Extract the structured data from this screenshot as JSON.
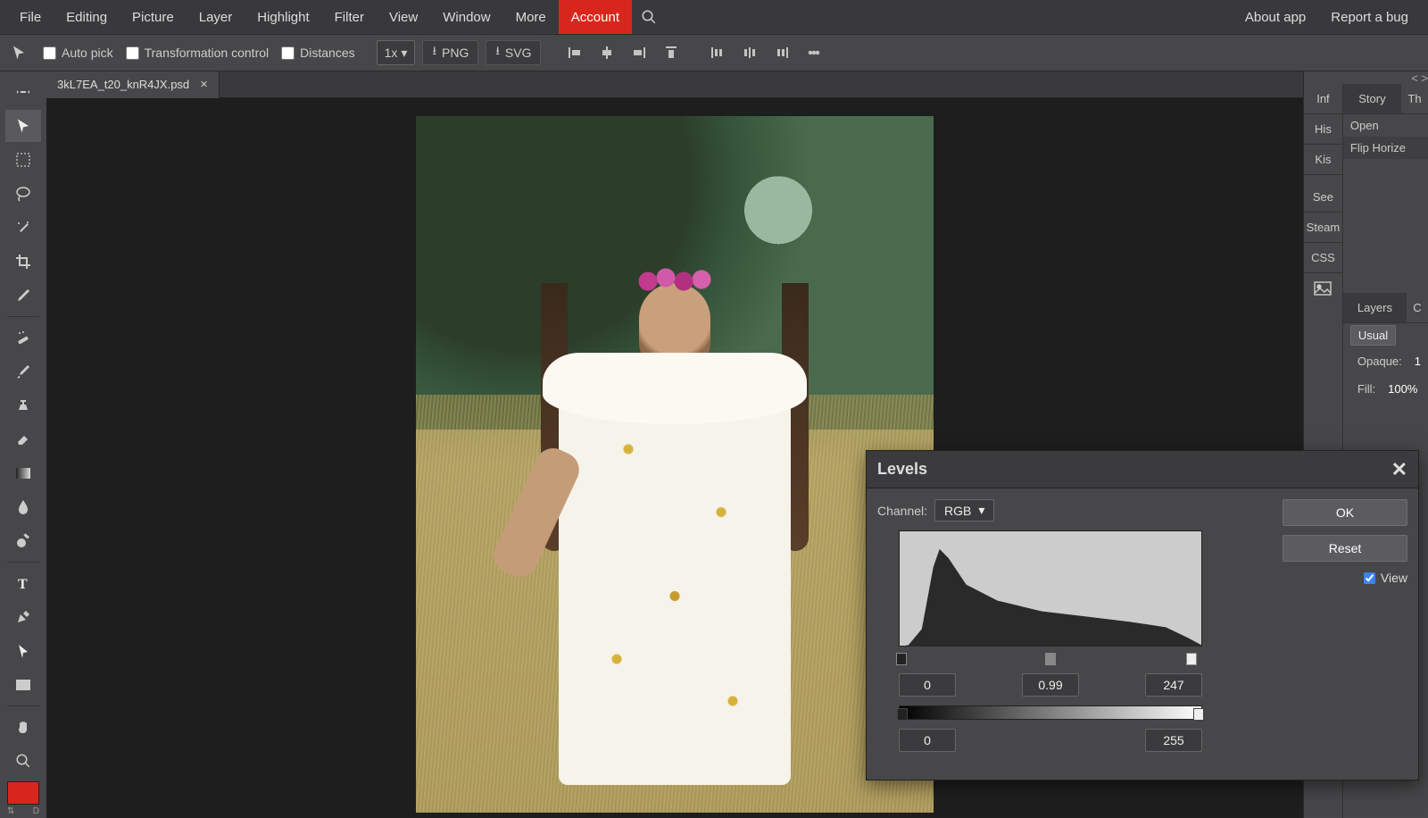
{
  "menubar": {
    "items": [
      "File",
      "Editing",
      "Picture",
      "Layer",
      "Highlight",
      "Filter",
      "View",
      "Window",
      "More",
      "Account"
    ],
    "right": [
      "About app",
      "Report a bug"
    ]
  },
  "toolbar": {
    "auto_pick": "Auto pick",
    "transformation": "Transformation control",
    "distances": "Distances",
    "zoom": "1x",
    "png": "PNG",
    "svg": "SVG"
  },
  "document": {
    "tab_name": "3kL7EA_t20_knR4JX.psd"
  },
  "right_panel": {
    "col1": [
      "Inf",
      "His",
      "Kis",
      "See",
      "Steam",
      "CSS"
    ],
    "story_tab": "Story",
    "th_tab": "Th",
    "open": "Open",
    "flip": "Flip Horize",
    "layers": "Layers",
    "layers_c": "C",
    "blend_mode": "Usual",
    "opaque_label": "Opaque:",
    "opaque_value": "1",
    "fill_label": "Fill:",
    "fill_value": "100%"
  },
  "levels_dialog": {
    "title": "Levels",
    "channel_label": "Channel:",
    "channel_value": "RGB",
    "input_black": "0",
    "input_gamma": "0.99",
    "input_white": "247",
    "output_black": "0",
    "output_white": "255",
    "ok": "OK",
    "reset": "Reset",
    "view": "View"
  }
}
